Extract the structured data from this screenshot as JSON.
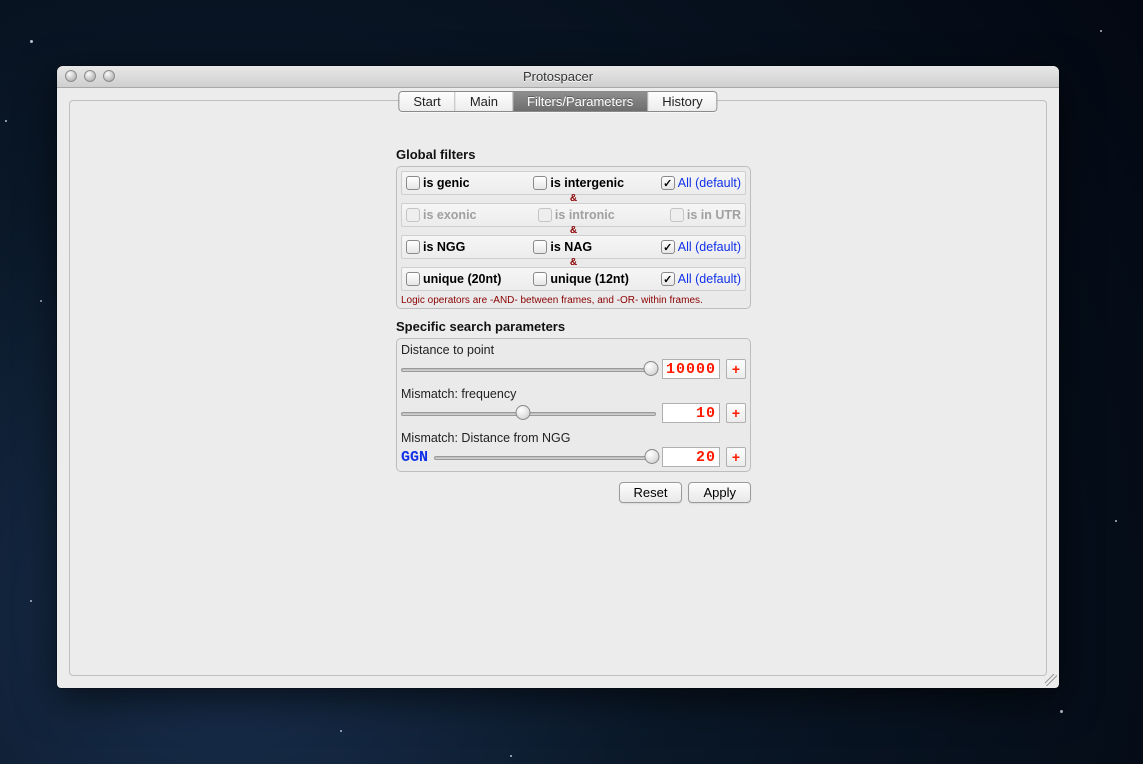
{
  "window": {
    "title": "Protospacer"
  },
  "tabs": [
    "Start",
    "Main",
    "Filters/Parameters",
    "History"
  ],
  "active_tab": 2,
  "global": {
    "heading": "Global filters",
    "rows": [
      {
        "enabled": true,
        "items": [
          {
            "label": "is genic",
            "checked": false
          },
          {
            "label": "is intergenic",
            "checked": false
          },
          {
            "label": "All (default)",
            "checked": true,
            "all": true
          }
        ]
      },
      {
        "enabled": false,
        "items": [
          {
            "label": "is exonic",
            "checked": false
          },
          {
            "label": "is intronic",
            "checked": false
          },
          {
            "label": "is in UTR",
            "checked": false
          }
        ]
      },
      {
        "enabled": true,
        "items": [
          {
            "label": "is NGG",
            "checked": false
          },
          {
            "label": "is NAG",
            "checked": false
          },
          {
            "label": "All (default)",
            "checked": true,
            "all": true
          }
        ]
      },
      {
        "enabled": true,
        "items": [
          {
            "label": "unique (20nt)",
            "checked": false
          },
          {
            "label": "unique (12nt)",
            "checked": false
          },
          {
            "label": "All (default)",
            "checked": true,
            "all": true
          }
        ]
      }
    ],
    "amp": "&",
    "hint": "Logic operators are -AND- between frames, and -OR- within frames."
  },
  "specific": {
    "heading": "Specific search parameters",
    "params": [
      {
        "label": "Distance to point",
        "value": "10000",
        "thumb": 98
      },
      {
        "label": "Mismatch: frequency",
        "value": "10",
        "thumb": 48
      },
      {
        "label": "Mismatch: Distance from NGG",
        "value": "20",
        "thumb": 98,
        "prefix": "GGN"
      }
    ],
    "plus": "+"
  },
  "buttons": {
    "reset": "Reset",
    "apply": "Apply"
  }
}
